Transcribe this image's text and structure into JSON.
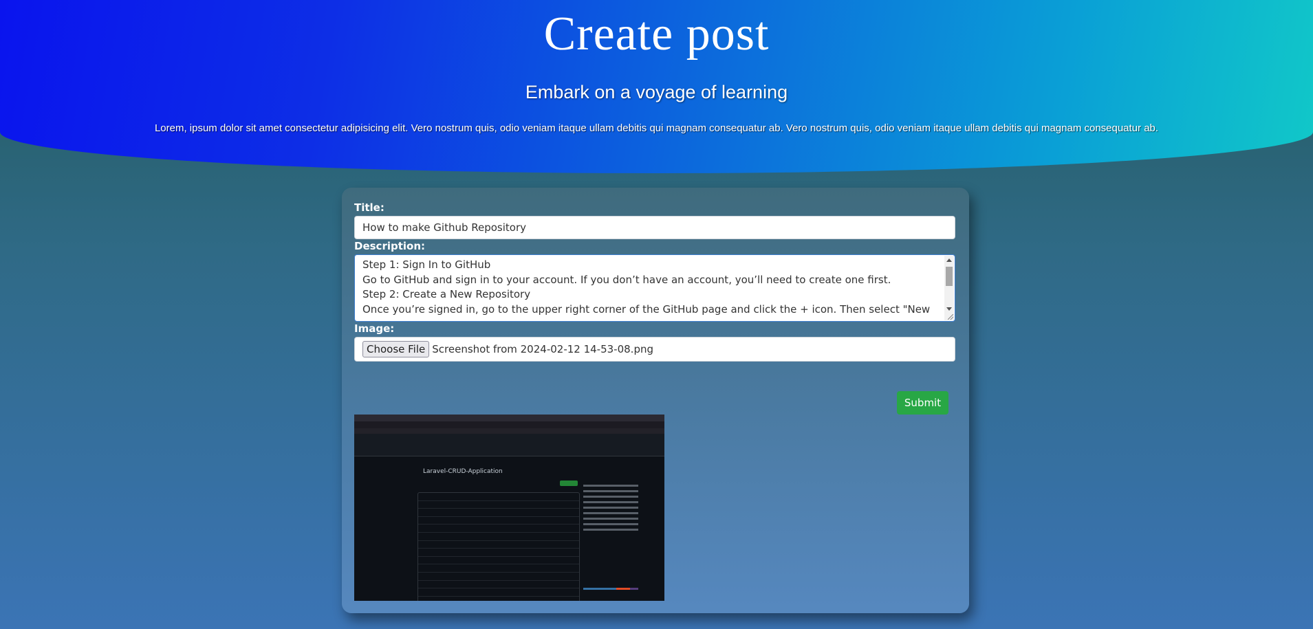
{
  "hero": {
    "title": "Create post",
    "subtitle": "Embark on a voyage of learning",
    "body": "Lorem, ipsum dolor sit amet consectetur adipisicing elit. Vero nostrum quis, odio veniam itaque ullam debitis qui magnam consequatur ab. Vero nostrum quis, odio veniam itaque ullam debitis qui magnam consequatur ab."
  },
  "form": {
    "title_label": "Title:",
    "title_value": "How to make Github Repository",
    "description_label": "Description:",
    "description_lines": [
      "Step 1: Sign In to GitHub",
      "Go to GitHub and sign in to your account. If you don’t have an account, you’ll need to create one first.",
      "Step 2: Create a New Repository",
      "Once you’re signed in, go to the upper right corner of the GitHub page and click the + icon. Then select \"New"
    ],
    "image_label": "Image:",
    "choose_file_label": "Choose File",
    "file_name": "Screenshot from 2024-02-12 14-53-08.png",
    "submit_label": "Submit"
  },
  "preview": {
    "repo_name": "Laravel-CRUD-Application"
  },
  "colors": {
    "submit": "#28a745",
    "hero_start": "#0a14ee",
    "hero_end": "#11c8c8"
  }
}
